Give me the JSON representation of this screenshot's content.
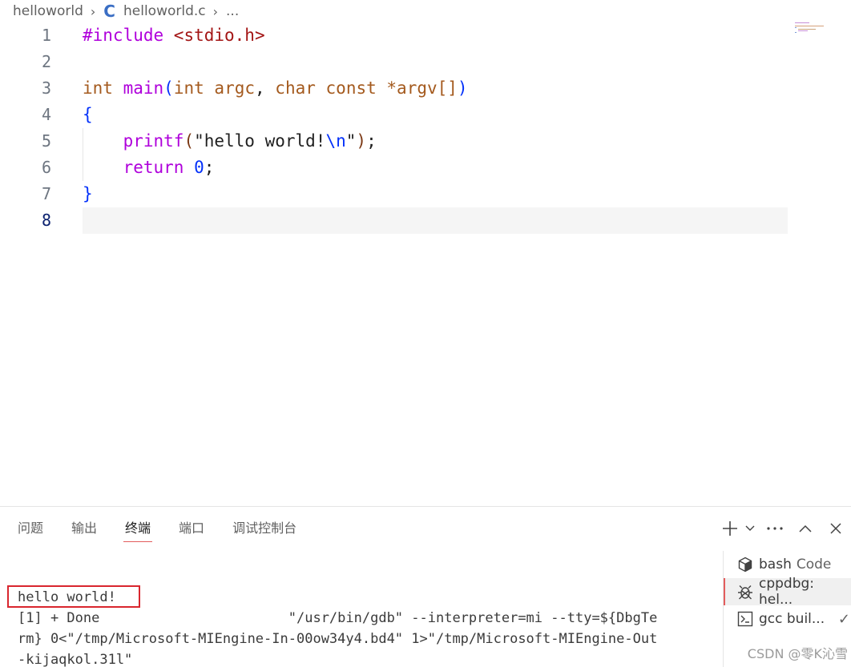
{
  "breadcrumb": {
    "folder": "helloworld",
    "file_icon": "C",
    "file": "helloworld.c",
    "ellipsis": "..."
  },
  "editor": {
    "language": "c",
    "active_line": 8,
    "lines": [
      {
        "number": "1",
        "text": "#include <stdio.h>"
      },
      {
        "number": "2",
        "text": ""
      },
      {
        "number": "3",
        "text": "int main(int argc, char const *argv[])"
      },
      {
        "number": "4",
        "text": "{"
      },
      {
        "number": "5",
        "text": "    printf(\"hello world!\\n\");"
      },
      {
        "number": "6",
        "text": "    return 0;"
      },
      {
        "number": "7",
        "text": "}"
      },
      {
        "number": "8",
        "text": ""
      }
    ]
  },
  "panel": {
    "tabs": [
      {
        "label": "问题",
        "active": false
      },
      {
        "label": "输出",
        "active": false
      },
      {
        "label": "终端",
        "active": true
      },
      {
        "label": "端口",
        "active": false
      },
      {
        "label": "调试控制台",
        "active": false
      }
    ],
    "actions": {
      "new_terminal_icon": "plus-icon",
      "dropdown_icon": "chevron-down-icon",
      "more_icon": "ellipsis-icon",
      "maximize_icon": "chevron-up-icon",
      "close_icon": "close-icon"
    },
    "terminal_output": {
      "line1": "hello world!",
      "line2": "[1] + Done                       \"/usr/bin/gdb\" --interpreter=mi --tty=${DbgTe",
      "line3": "rm} 0<\"/tmp/Microsoft-MIEngine-In-00ow34y4.bd4\" 1>\"/tmp/Microsoft-MIEngine-Out",
      "line4": "-kijaqkol.31l\""
    },
    "terminals": [
      {
        "name": "bash",
        "sub": "Code",
        "icon": "package-icon",
        "active": false
      },
      {
        "name": "cppdbg: hel...",
        "sub": "",
        "icon": "debug-icon",
        "active": true
      },
      {
        "name": "gcc buil...",
        "sub": "",
        "icon": "terminal-icon",
        "active": false,
        "check": "✓"
      }
    ]
  },
  "watermark": "CSDN @零K沁雪",
  "colors": {
    "accent_tab": "#e35d5d",
    "highlight_box": "#d9262e",
    "file_icon": "#3a6ec4"
  }
}
